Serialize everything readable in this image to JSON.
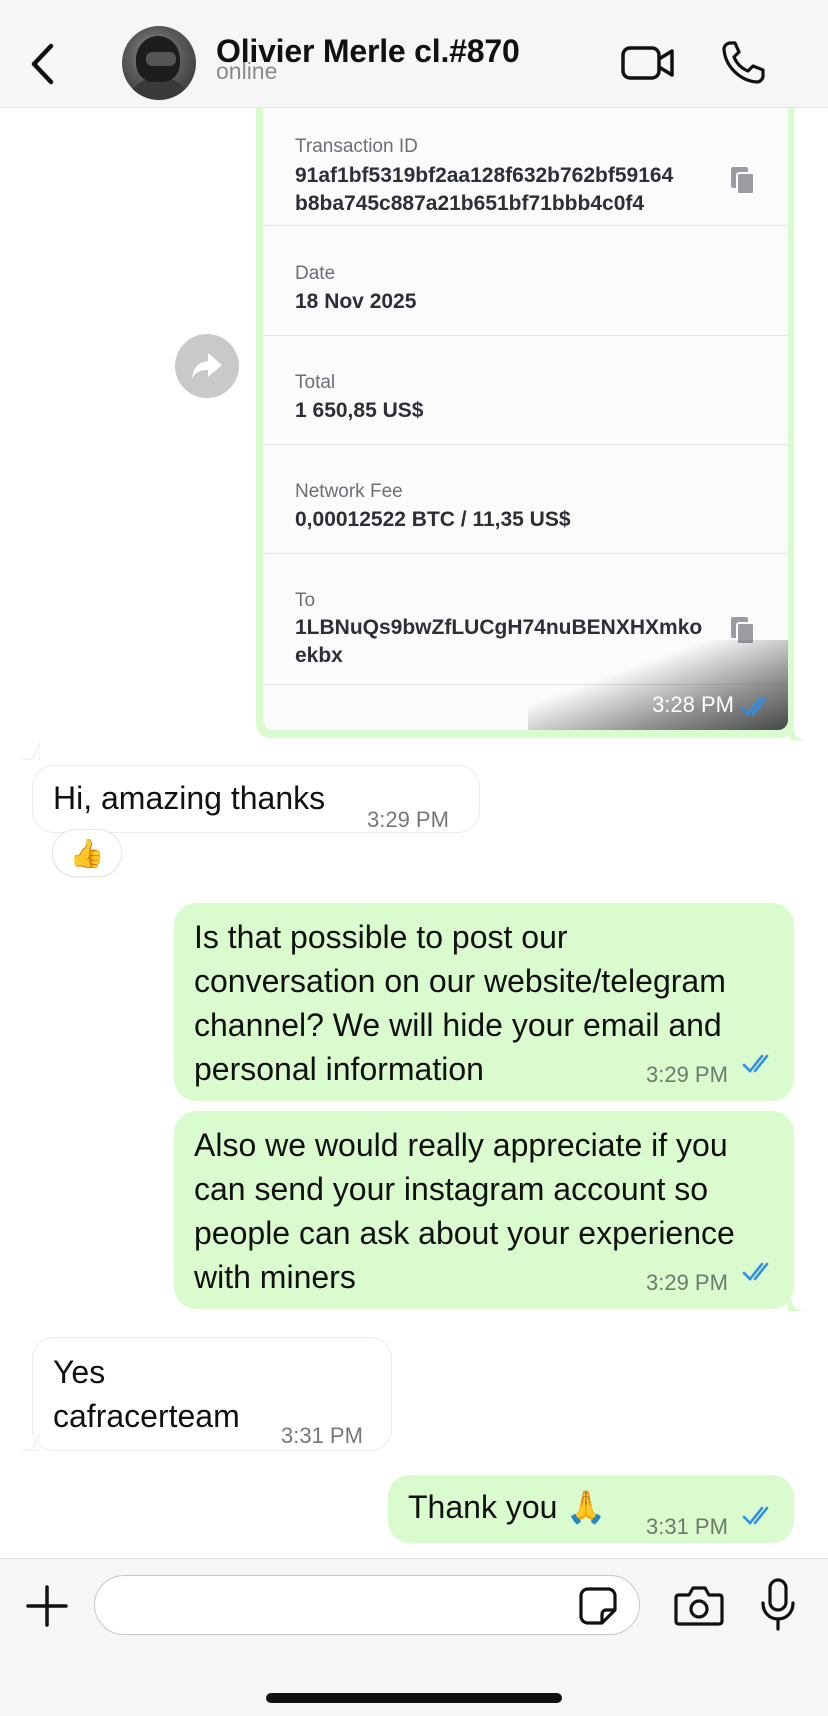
{
  "header": {
    "back_label": "",
    "contact_name": "Olivier Merle cl.#870",
    "status": "online"
  },
  "transaction_card": {
    "fields": [
      {
        "label": "Transaction ID",
        "value": "91af1bf5319bf2aa128f632b762bf59164\nb8ba745c887a21b651bf71bbb4c0f4"
      },
      {
        "label": "Date",
        "value": "18 Nov 2025"
      },
      {
        "label": "Total",
        "value": "1 650,85 US$"
      },
      {
        "label": "Network Fee",
        "value": "0,00012522 BTC / 11,35 US$"
      },
      {
        "label": "To",
        "value": "1LBNuQs9bwZfLUCgH74nuBENXHXmko\nekbx"
      }
    ],
    "time": "3:28 PM"
  },
  "messages": [
    {
      "direction": "in",
      "text": "Hi, amazing thanks",
      "time": "3:29 PM",
      "reaction": "👍"
    },
    {
      "direction": "out",
      "text": "Is that possible to post our\nconversation on our website/telegram\nchannel? We will hide your email and\npersonal information",
      "time": "3:29 PM"
    },
    {
      "direction": "out",
      "text": "Also we would really appreciate if you\ncan send your instagram account so\npeople can ask about your experience\nwith miners",
      "time": "3:29 PM"
    },
    {
      "direction": "in",
      "text": "Yes\ncafracerteam",
      "time": "3:31 PM"
    },
    {
      "direction": "out",
      "text": "Thank you 🙏",
      "time": "3:31 PM"
    }
  ],
  "input": {
    "placeholder": "",
    "value": ""
  },
  "icons": {
    "back": "chevron-left-icon",
    "video": "video-camera-icon",
    "call": "phone-icon",
    "forward": "forward-arrow-icon",
    "copy": "copy-icon",
    "read": "double-check-icon",
    "plus": "plus-icon",
    "sticker": "sticker-icon",
    "camera": "camera-icon",
    "mic": "microphone-icon"
  },
  "colors": {
    "outgoing_bubble": "#d9fbce",
    "incoming_bubble": "#ffffff",
    "read_check": "#2f8fe8",
    "header_bg": "#f6f6f6"
  }
}
